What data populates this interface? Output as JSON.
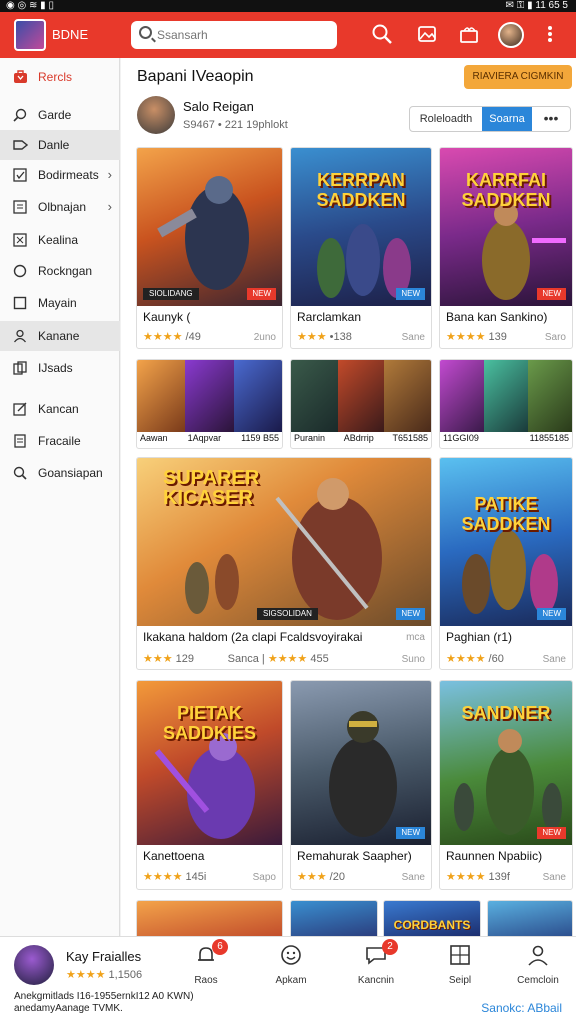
{
  "status": {
    "left": "◉  ◎  ≋  ▮  ▯",
    "right": "✉ ⚿ ▮ 11 65 5"
  },
  "topbar": {
    "brand": "BDNE",
    "search_placeholder": "Ssansarh",
    "icons": [
      "search-icon",
      "image-icon",
      "gift-icon",
      "avatar",
      "more-icon"
    ]
  },
  "sidebar": {
    "items": [
      {
        "label": "Rercls",
        "icon": "bag-icon"
      },
      {
        "label": "Garde",
        "icon": "search-icon"
      },
      {
        "label": "Danle",
        "icon": "tag-icon"
      },
      {
        "label": "Bodirmeats",
        "icon": "check-box-icon"
      },
      {
        "label": "Olbnajan",
        "icon": "doc-check-icon"
      },
      {
        "label": "Kealina",
        "icon": "cross-box-icon"
      },
      {
        "label": "Rockngan",
        "icon": "circle-icon"
      },
      {
        "label": "Mayain",
        "icon": "square-icon"
      },
      {
        "label": "Kanane",
        "icon": "person-icon"
      },
      {
        "label": "IJsads",
        "icon": "copy-icon"
      },
      {
        "label": "Kancan",
        "icon": "edit-box-icon"
      },
      {
        "label": "Fracaile",
        "icon": "doc-icon"
      },
      {
        "label": "Goansiapan",
        "icon": "search-icon"
      }
    ]
  },
  "main": {
    "title": "Bapani IVeaopin",
    "action_button": "RIAVIERA CIGMKIN",
    "user": {
      "name": "Salo Reigan",
      "stats": "S9467 • 221 19phlokt"
    },
    "segmented": {
      "left": "Roleloadth",
      "right": "Soarna",
      "more": "•••"
    }
  },
  "cards": {
    "row1": [
      {
        "art_title": "",
        "tag_left": "SIOLIDANG",
        "tag_right": "NEW",
        "name": "Kaunyk (",
        "stars": "★★★★",
        "rating": "/49",
        "meta": "2uno"
      },
      {
        "art_title": "KERRPAN SADDKEN",
        "tag_left": "",
        "tag_right": "NEW",
        "name": "Rarclamkan",
        "stars": "★★★",
        "rating": "•138",
        "meta": "Sane"
      },
      {
        "art_title": "KARRFAI SADDKEN",
        "tag_left": "",
        "tag_right": "NEW",
        "name": "Bana kan Sankino)",
        "stars": "★★★★",
        "rating": "139",
        "meta": "Saro"
      }
    ],
    "tiles": [
      {
        "labels": [
          "Aawan",
          "1Aqpvar",
          "1159 B55"
        ]
      },
      {
        "labels": [
          "Puranin",
          "ABdrrip",
          "T651585"
        ]
      },
      {
        "labels": [
          "11GGI09",
          "11855185"
        ]
      }
    ],
    "featured": {
      "art_title": "SUPARER KICASER",
      "tag_left": "SIGSOLIDAN",
      "tag_right": "NEW",
      "name": "Ikakana haldom (2a clapi Fcaldsvoyirakai",
      "stars": "★★★",
      "rating": "129",
      "meta_mid": "Sanca",
      "stars2": "★★★★",
      "rating2": "455",
      "meta": "mca",
      "meta2": "Suno"
    },
    "featured_side": {
      "art_title": "PATIKE SADDKEN",
      "tag_right": "NEW",
      "name": "Paghian (r1)",
      "stars": "★★★★",
      "rating": "/60",
      "meta": "Sane"
    },
    "row3": [
      {
        "art_title": "PIETAK SADDKIES",
        "tag_right": "",
        "name": "Kanettoena",
        "stars": "★★★★",
        "rating": "145i",
        "meta": "Sapo"
      },
      {
        "art_title": "",
        "tag_right": "NEW",
        "name": "Remahurak Saapher)",
        "stars": "★★★",
        "rating": "/20",
        "meta": "Sane"
      },
      {
        "art_title": "SANDNER",
        "tag_right": "NEW",
        "name": "Raunnen Npabiic)",
        "stars": "★★★★",
        "rating": "139f",
        "meta": "Sane"
      }
    ],
    "row4": [
      {
        "art_title": ""
      },
      {
        "art_title": ""
      },
      {
        "art_title": "CORDBANTS"
      },
      {
        "art_title": ""
      }
    ]
  },
  "bottombar": {
    "name": "Kay Fraialles",
    "stars": "★★★★",
    "rating": "1,1506",
    "nav": [
      {
        "label": "Raos",
        "icon": "bell-icon",
        "badge": "6"
      },
      {
        "label": "Apkam",
        "icon": "smiley-icon",
        "badge": ""
      },
      {
        "label": "Kancnin",
        "icon": "chat-icon",
        "badge": "2"
      },
      {
        "label": "Seipl",
        "icon": "grid-icon",
        "badge": ""
      },
      {
        "label": "Cemcloin",
        "icon": "person-icon",
        "badge": ""
      }
    ],
    "footer_line1": "Anekgmitlads I16-1955ernkI12 A0 KWN)",
    "footer_line2": "anedamyAanage TVMK.",
    "link": "Sanokc: ABbail"
  },
  "colors": {
    "brand_red": "#e8392b",
    "accent_blue": "#2b86d9",
    "orange": "#f3a73a",
    "star": "#f0a21a"
  }
}
